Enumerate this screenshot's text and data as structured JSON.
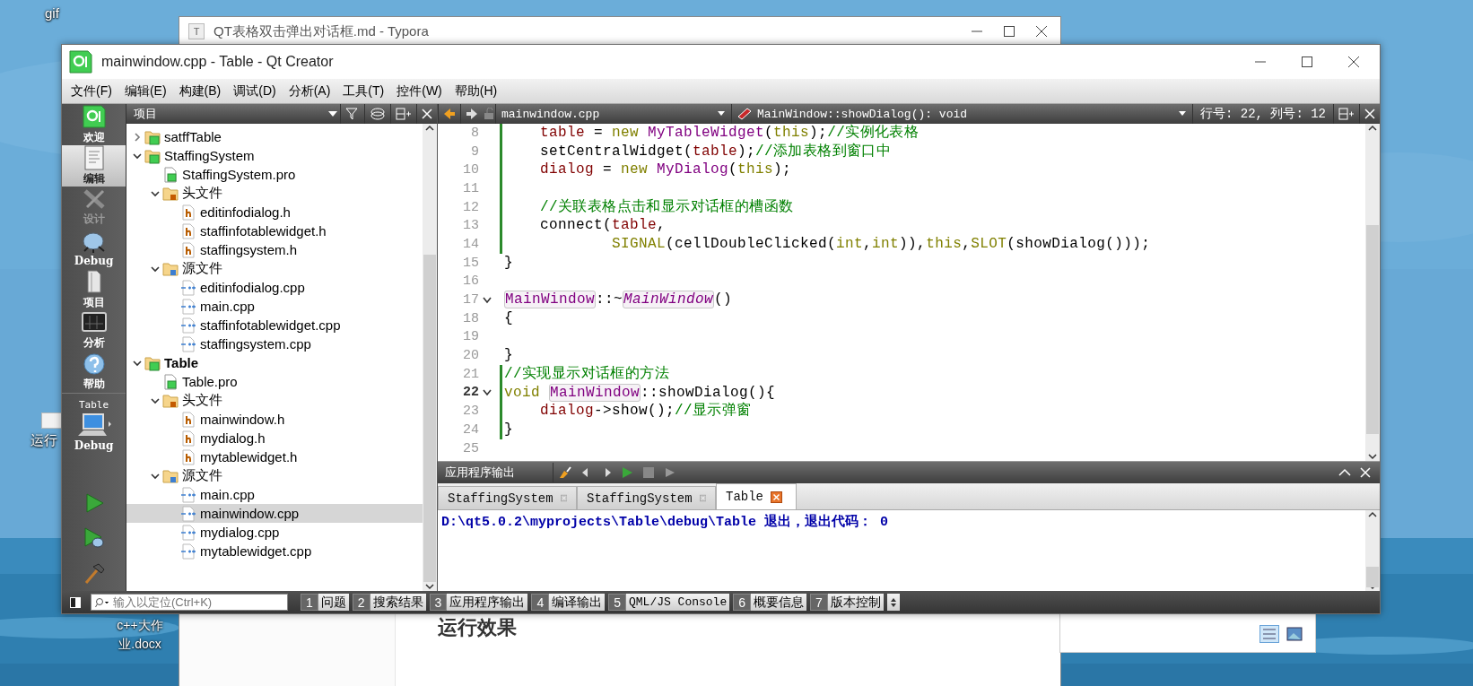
{
  "desktop": {
    "icons": [
      {
        "label": "gif"
      },
      {
        "label": "运行"
      },
      {
        "label": "c++大作业.docx"
      }
    ]
  },
  "typora": {
    "icon_letter": "T",
    "title": "QT表格双击弹出对话框.md - Typora",
    "heading": "运行效果"
  },
  "qt": {
    "title": "mainwindow.cpp - Table - Qt Creator",
    "menu": [
      "文件(F)",
      "编辑(E)",
      "构建(B)",
      "调试(D)",
      "分析(A)",
      "工具(T)",
      "控件(W)",
      "帮助(H)"
    ],
    "modes": [
      {
        "label": "欢迎",
        "kind": "welcome",
        "selected": false,
        "disabled": false
      },
      {
        "label": "编辑",
        "kind": "edit",
        "selected": true,
        "disabled": false
      },
      {
        "label": "设计",
        "kind": "design",
        "selected": false,
        "disabled": true
      },
      {
        "label": "Debug",
        "kind": "debug",
        "selected": false,
        "disabled": false
      },
      {
        "label": "项目",
        "kind": "projects",
        "selected": false,
        "disabled": false
      },
      {
        "label": "分析",
        "kind": "analyze",
        "selected": false,
        "disabled": false
      },
      {
        "label": "帮助",
        "kind": "help",
        "selected": false,
        "disabled": false
      }
    ],
    "target": {
      "project": "Table",
      "config": "Debug"
    },
    "actions": [
      {
        "kind": "run"
      },
      {
        "kind": "debug-run"
      },
      {
        "kind": "build"
      }
    ],
    "project_panel": {
      "title": "项目",
      "tree": [
        {
          "label": "satffTable",
          "kind": "project",
          "expanded": false,
          "active": false,
          "selected": false
        },
        {
          "label": "StaffingSystem",
          "kind": "project",
          "expanded": true,
          "active": false,
          "selected": false,
          "children": [
            {
              "label": "StaffingSystem.pro",
              "kind": "pro",
              "selected": false
            },
            {
              "label": "头文件",
              "kind": "headers",
              "expanded": true,
              "selected": false,
              "children": [
                {
                  "label": "editinfodialog.h",
                  "kind": "h",
                  "selected": false
                },
                {
                  "label": "staffinfotablewidget.h",
                  "kind": "h",
                  "selected": false
                },
                {
                  "label": "staffingsystem.h",
                  "kind": "h",
                  "selected": false
                }
              ]
            },
            {
              "label": "源文件",
              "kind": "sources",
              "expanded": true,
              "selected": false,
              "children": [
                {
                  "label": "editinfodialog.cpp",
                  "kind": "cpp",
                  "selected": false
                },
                {
                  "label": "main.cpp",
                  "kind": "cpp",
                  "selected": false
                },
                {
                  "label": "staffinfotablewidget.cpp",
                  "kind": "cpp",
                  "selected": false
                },
                {
                  "label": "staffingsystem.cpp",
                  "kind": "cpp",
                  "selected": false
                }
              ]
            }
          ]
        },
        {
          "label": "Table",
          "kind": "project",
          "expanded": true,
          "active": true,
          "selected": false,
          "children": [
            {
              "label": "Table.pro",
              "kind": "pro",
              "selected": false
            },
            {
              "label": "头文件",
              "kind": "headers",
              "expanded": true,
              "selected": false,
              "children": [
                {
                  "label": "mainwindow.h",
                  "kind": "h",
                  "selected": false
                },
                {
                  "label": "mydialog.h",
                  "kind": "h",
                  "selected": false
                },
                {
                  "label": "mytablewidget.h",
                  "kind": "h",
                  "selected": false
                }
              ]
            },
            {
              "label": "源文件",
              "kind": "sources",
              "expanded": true,
              "selected": false,
              "children": [
                {
                  "label": "main.cpp",
                  "kind": "cpp",
                  "selected": false
                },
                {
                  "label": "mainwindow.cpp",
                  "kind": "cpp",
                  "selected": true
                },
                {
                  "label": "mydialog.cpp",
                  "kind": "cpp",
                  "selected": false
                },
                {
                  "label": "mytablewidget.cpp",
                  "kind": "cpp",
                  "selected": false
                }
              ]
            }
          ]
        }
      ]
    },
    "editor": {
      "file": "mainwindow.cpp",
      "symbol": "MainWindow::showDialog(): void",
      "position": "行号: 22, 列号: 12",
      "lines": [
        {
          "number": "8",
          "current": false,
          "foldable": false,
          "changed": true,
          "segments": [
            {
              "kind": "field",
              "text": "    table"
            },
            {
              "kind": "plain",
              "text": " = "
            },
            {
              "kind": "keyword",
              "text": "new "
            },
            {
              "kind": "type",
              "text": "MyTableWidget"
            },
            {
              "kind": "plain",
              "text": "("
            },
            {
              "kind": "keyword",
              "text": "this"
            },
            {
              "kind": "plain",
              "text": ");"
            },
            {
              "kind": "comment",
              "text": "//实例化表格"
            }
          ]
        },
        {
          "number": "9",
          "current": false,
          "foldable": false,
          "changed": true,
          "segments": [
            {
              "kind": "plain",
              "text": "    setCentralWidget("
            },
            {
              "kind": "field",
              "text": "table"
            },
            {
              "kind": "plain",
              "text": ");"
            },
            {
              "kind": "comment",
              "text": "//添加表格到窗口中"
            }
          ]
        },
        {
          "number": "10",
          "current": false,
          "foldable": false,
          "changed": true,
          "segments": [
            {
              "kind": "field",
              "text": "    dialog"
            },
            {
              "kind": "plain",
              "text": " = "
            },
            {
              "kind": "keyword",
              "text": "new "
            },
            {
              "kind": "type",
              "text": "MyDialog"
            },
            {
              "kind": "plain",
              "text": "("
            },
            {
              "kind": "keyword",
              "text": "this"
            },
            {
              "kind": "plain",
              "text": ");"
            }
          ]
        },
        {
          "number": "11",
          "current": false,
          "foldable": false,
          "changed": true
        },
        {
          "number": "12",
          "current": false,
          "foldable": false,
          "changed": true,
          "segments": [
            {
              "kind": "comment",
              "text": "    //关联表格点击和显示对话框的槽函数"
            }
          ]
        },
        {
          "number": "13",
          "current": false,
          "foldable": false,
          "changed": true,
          "segments": [
            {
              "kind": "plain",
              "text": "    connect("
            },
            {
              "kind": "field",
              "text": "table"
            },
            {
              "kind": "plain",
              "text": ","
            }
          ]
        },
        {
          "number": "14",
          "current": false,
          "foldable": false,
          "changed": true,
          "segments": [
            {
              "kind": "keyword",
              "text": "            SIGNAL"
            },
            {
              "kind": "plain",
              "text": "(cellDoubleClicked("
            },
            {
              "kind": "keyword",
              "text": "int"
            },
            {
              "kind": "plain",
              "text": ","
            },
            {
              "kind": "keyword",
              "text": "int"
            },
            {
              "kind": "plain",
              "text": ")),"
            },
            {
              "kind": "keyword",
              "text": "this"
            },
            {
              "kind": "plain",
              "text": ","
            },
            {
              "kind": "keyword",
              "text": "SLOT"
            },
            {
              "kind": "plain",
              "text": "(showDialog()));"
            }
          ]
        },
        {
          "number": "15",
          "current": false,
          "foldable": false,
          "changed": false,
          "segments": [
            {
              "kind": "plain",
              "text": "}"
            }
          ]
        },
        {
          "number": "16",
          "current": false,
          "foldable": false,
          "changed": false
        },
        {
          "number": "17",
          "current": false,
          "foldable": true,
          "changed": false,
          "segments": [
            {
              "kind": "ref",
              "text": "MainWindow"
            },
            {
              "kind": "plain",
              "text": "::~"
            },
            {
              "kind": "refitalic",
              "text": "MainWindow"
            },
            {
              "kind": "plain",
              "text": "()"
            }
          ]
        },
        {
          "number": "18",
          "current": false,
          "foldable": false,
          "changed": false,
          "segments": [
            {
              "kind": "plain",
              "text": "{"
            }
          ]
        },
        {
          "number": "19",
          "current": false,
          "foldable": false,
          "changed": false
        },
        {
          "number": "20",
          "current": false,
          "foldable": false,
          "changed": false,
          "segments": [
            {
              "kind": "plain",
              "text": "}"
            }
          ]
        },
        {
          "number": "21",
          "current": false,
          "foldable": false,
          "changed": true,
          "segments": [
            {
              "kind": "comment",
              "text": "//实现显示对话框的方法"
            }
          ]
        },
        {
          "number": "22",
          "current": true,
          "foldable": true,
          "changed": true,
          "segments": [
            {
              "kind": "keyword",
              "text": "void "
            },
            {
              "kind": "ref",
              "text": "MainWindow"
            },
            {
              "kind": "plain",
              "text": "::showDialog(){"
            }
          ]
        },
        {
          "number": "23",
          "current": false,
          "foldable": false,
          "changed": true,
          "segments": [
            {
              "kind": "field",
              "text": "    dialog"
            },
            {
              "kind": "plain",
              "text": "->show();"
            },
            {
              "kind": "comment",
              "text": "//显示弹窗"
            }
          ]
        },
        {
          "number": "24",
          "current": false,
          "foldable": false,
          "changed": true,
          "segments": [
            {
              "kind": "plain",
              "text": "}"
            }
          ]
        },
        {
          "number": "25",
          "current": false,
          "foldable": false,
          "changed": false
        }
      ]
    },
    "output": {
      "title": "应用程序输出",
      "tabs": [
        {
          "label": "StaffingSystem",
          "selected": false
        },
        {
          "label": "StaffingSystem",
          "selected": false
        },
        {
          "label": "Table",
          "selected": true
        }
      ],
      "text": "D:\\qt5.0.2\\myprojects\\Table\\debug\\Table 退出，退出代码： 0"
    },
    "bottom_bar": {
      "locator_placeholder": "输入以定位(Ctrl+K)",
      "panes": [
        {
          "number": "1",
          "label": "问题"
        },
        {
          "number": "2",
          "label": "搜索结果"
        },
        {
          "number": "3",
          "label": "应用程序输出"
        },
        {
          "number": "4",
          "label": "编译输出"
        },
        {
          "number": "5",
          "label": "QML/JS Console"
        },
        {
          "number": "6",
          "label": "概要信息"
        },
        {
          "number": "7",
          "label": "版本控制"
        }
      ]
    }
  }
}
